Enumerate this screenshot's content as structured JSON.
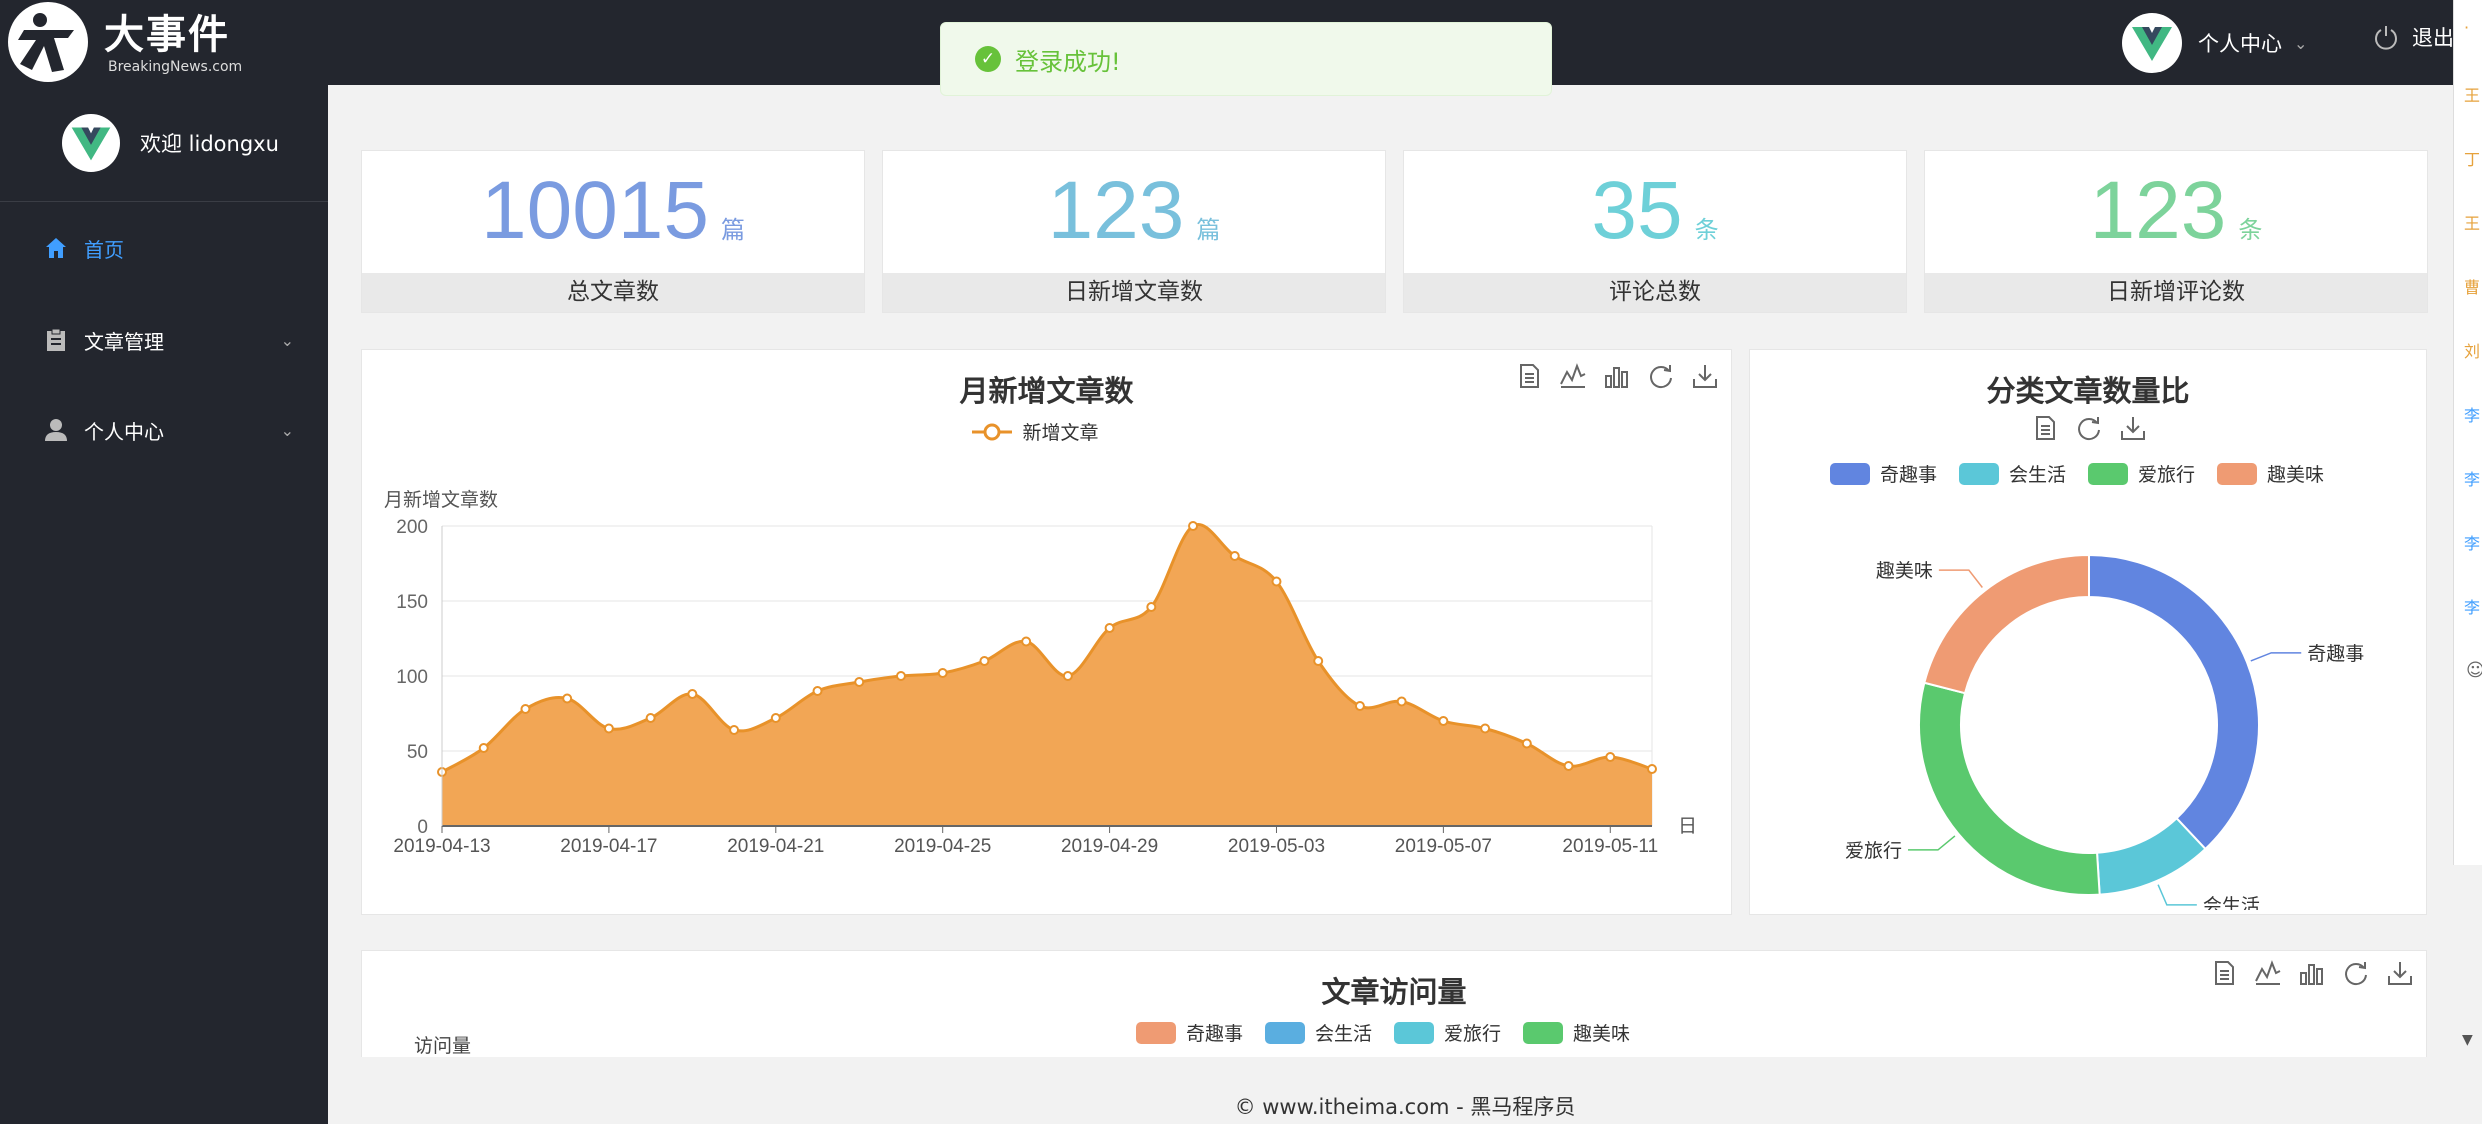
{
  "app": {
    "logo_cn": "大事件",
    "logo_en": "BreakingNews.com"
  },
  "toast": {
    "message": "登录成功!"
  },
  "header": {
    "user_label": "个人中心",
    "logout_label": "退出"
  },
  "sidebar": {
    "welcome": "欢迎 lidongxu",
    "items": [
      {
        "label": "首页",
        "icon": "home-icon",
        "active": true
      },
      {
        "label": "文章管理",
        "icon": "clipboard-icon",
        "active": false
      },
      {
        "label": "个人中心",
        "icon": "user-icon",
        "active": false
      }
    ]
  },
  "stats": [
    {
      "value": "10015",
      "unit": "篇",
      "label": "总文章数",
      "color": "#7a9be0"
    },
    {
      "value": "123",
      "unit": "篇",
      "label": "日新增文章数",
      "color": "#79c0dc"
    },
    {
      "value": "35",
      "unit": "条",
      "label": "评论总数",
      "color": "#6ed0d8"
    },
    {
      "value": "123",
      "unit": "条",
      "label": "日新增评论数",
      "color": "#7dd39b"
    }
  ],
  "colors": {
    "area": "#f2a655",
    "line": "#e8922a",
    "accent": "#409eff"
  },
  "toolbox_icons": [
    "data-view-icon",
    "line-chart-icon",
    "bar-chart-icon",
    "refresh-icon",
    "download-icon"
  ],
  "chart_data": [
    {
      "type": "area",
      "title": "月新增文章数",
      "ylabel": "月新增文章数",
      "xlabel": "日",
      "legend": [
        "新增文章"
      ],
      "ylim": [
        0,
        200
      ],
      "yticks": [
        0,
        50,
        100,
        150,
        200
      ],
      "xtick_labels": [
        "2019-04-13",
        "2019-04-17",
        "2019-04-21",
        "2019-04-25",
        "2019-04-29",
        "2019-05-03",
        "2019-05-07",
        "2019-05-11"
      ],
      "x": [
        "2019-04-13",
        "2019-04-14",
        "2019-04-15",
        "2019-04-16",
        "2019-04-17",
        "2019-04-18",
        "2019-04-19",
        "2019-04-20",
        "2019-04-21",
        "2019-04-22",
        "2019-04-23",
        "2019-04-24",
        "2019-04-25",
        "2019-04-26",
        "2019-04-27",
        "2019-04-28",
        "2019-04-29",
        "2019-04-30",
        "2019-05-01",
        "2019-05-02",
        "2019-05-03",
        "2019-05-04",
        "2019-05-05",
        "2019-05-06",
        "2019-05-07",
        "2019-05-08",
        "2019-05-09",
        "2019-05-10",
        "2019-05-11",
        "2019-05-12"
      ],
      "series": [
        {
          "name": "新增文章",
          "values": [
            36,
            52,
            78,
            85,
            65,
            72,
            88,
            64,
            72,
            90,
            96,
            100,
            102,
            110,
            123,
            100,
            132,
            146,
            200,
            180,
            163,
            110,
            80,
            83,
            70,
            65,
            55,
            40,
            46,
            38
          ]
        }
      ],
      "grid": true,
      "legend_position": "top-center"
    },
    {
      "type": "pie",
      "title": "分类文章数量比",
      "legend": [
        "奇趣事",
        "会生活",
        "爱旅行",
        "趣美味"
      ],
      "slices": [
        {
          "name": "奇趣事",
          "value": 38,
          "color": "#6185e0"
        },
        {
          "name": "会生活",
          "value": 11,
          "color": "#5bc7d8"
        },
        {
          "name": "爱旅行",
          "value": 30,
          "color": "#5ac96e"
        },
        {
          "name": "趣美味",
          "value": 21,
          "color": "#ef9b73"
        }
      ],
      "legend_position": "top-center"
    },
    {
      "type": "bar",
      "title": "文章访问量",
      "ylabel": "访问量",
      "legend": [
        {
          "name": "奇趣事",
          "color": "#ef9b73"
        },
        {
          "name": "会生活",
          "color": "#5aaee0"
        },
        {
          "name": "爱旅行",
          "color": "#5bc7d8"
        },
        {
          "name": "趣美味",
          "color": "#5ac96e"
        }
      ],
      "legend_position": "top-center"
    }
  ],
  "footer": {
    "text": "© www.itheima.com - 黑马程序员"
  },
  "side_panel": {
    "rows": [
      "王",
      "丁",
      "王",
      "曹",
      "刘"
    ],
    "links": [
      "李",
      "李",
      "李",
      "李"
    ]
  }
}
